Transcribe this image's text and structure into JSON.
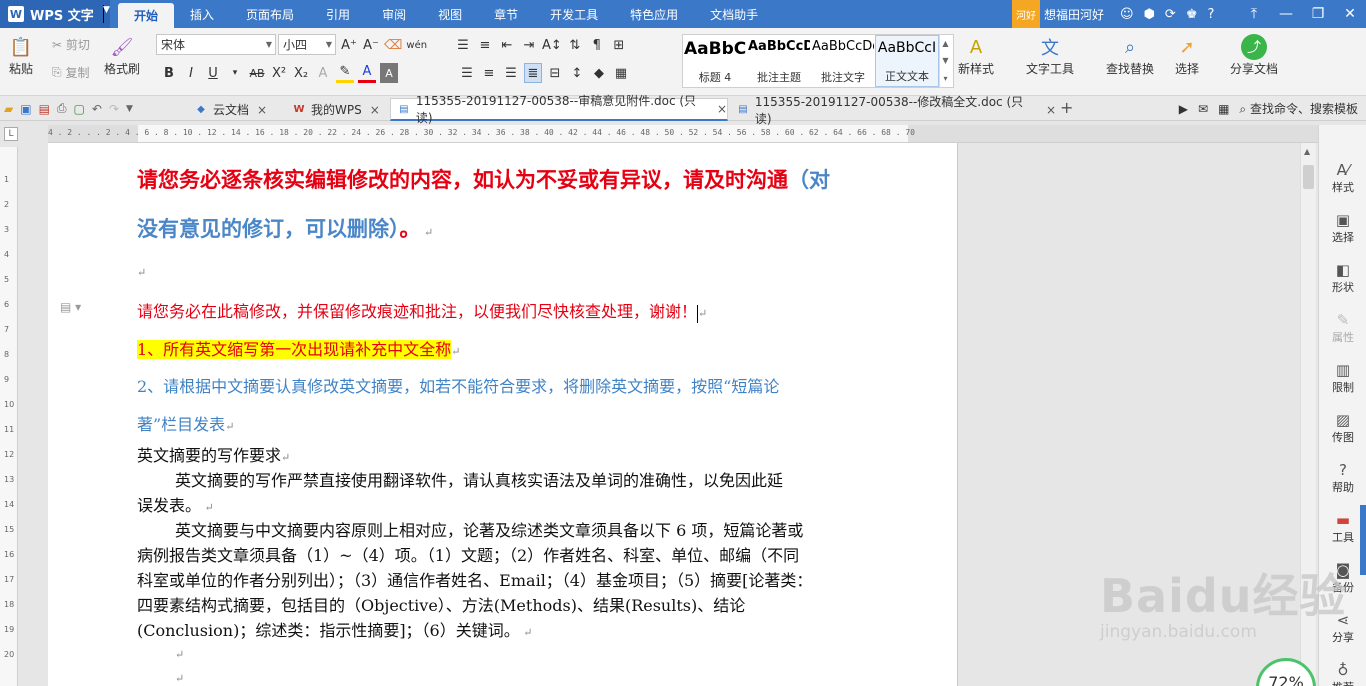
{
  "app": {
    "name": "WPS 文字",
    "logo": "W"
  },
  "menu": {
    "tabs": [
      "开始",
      "插入",
      "页面布局",
      "引用",
      "审阅",
      "视图",
      "章节",
      "开发工具",
      "特色应用",
      "文档助手"
    ],
    "user_badge": "河好",
    "user_name": "想福田河好"
  },
  "ribbon": {
    "paste": "粘贴",
    "cut": "剪切",
    "copy": "复制",
    "format_painter": "格式刷",
    "font_name": "宋体",
    "font_size": "小四",
    "styles": [
      {
        "sample": "AaBbC",
        "label": "标题 4"
      },
      {
        "sample": "AaBbCcDc",
        "label": "批注主题"
      },
      {
        "sample": "AaBbCcDd",
        "label": "批注文字"
      },
      {
        "sample": "AaBbCcI",
        "label": "正文文本"
      }
    ],
    "new_style": "新样式",
    "text_tools": "文字工具",
    "find_replace": "查找替换",
    "select": "选择",
    "share": "分享文档"
  },
  "tabs": {
    "cloud": "云文档",
    "mywps": "我的WPS",
    "doc1": "115355-20191127-00538--审稿意见附件.doc (只读)",
    "doc2": "115355-20191127-00538--修改稿全文.doc (只读)",
    "search": "查找命令、搜索模板"
  },
  "document": {
    "heading_red": "请您务必逐条核实编辑修改的内容，如认为不妥或有异议，请及时沟通",
    "heading_blue_1": "（对",
    "heading_blue_2": "没有意见的修订，可以删除）",
    "heading_end": "。",
    "note_red": "请您务必在此稿修改，并保留修改痕迹和批注，以便我们尽快核查处理，谢谢！",
    "item1": "1、所有英文缩写第一次出现请补充中文全称",
    "item2_a": "2、请根据中文摘要认真修改英文摘要，如若不能符合要求，将删除英文摘要，按照“短篇论",
    "item2_b": "著”栏目发表",
    "sub_title": "英文摘要的写作要求",
    "p1_a": "英文摘要的写作严禁直接使用翻译软件，请认真核实语法及单词的准确性，以免因此延",
    "p1_b": "误发表。",
    "p2_a": "英文摘要与中文摘要内容原则上相对应，论著及综述类文章须具备以下 6 项，短篇论著或",
    "p2_b": "病例报告类文章须具备（1）~（4）项。（1）文题；（2）作者姓名、科室、单位、邮编（不同",
    "p2_c": "科室或单位的作者分别列出）；（3）通信作者姓名、Email；（4）基金项目；（5）摘要[论著类：",
    "p2_d": "四要素结构式摘要，包括目的（Objective）、方法(Methods)、结果(Results)、结论",
    "p2_e": "(Conclusion)；综述类：指示性摘要]；（6）关键词。"
  },
  "side_panel": [
    "样式",
    "选择",
    "形状",
    "属性",
    "限制",
    "传图",
    "帮助",
    "工具",
    "备份",
    "分享",
    "推荐"
  ],
  "ruler_numbers": "4 . 2 . . . 2 . 4 . 6 . 8 . 10 . 12 . 14 . 16 . 18 . 20 . 22 . 24 . 26 . 28 . 30 . 32 . 34 . 36 . 38 . 40 . 42 . 44 . 46 . 48 . 50 . 52 . 54 . 56 . 58 . 60 . 62 . 64 . 66 . 68 . 70",
  "vruler_numbers": [
    "1",
    "2",
    "3",
    "4",
    "5",
    "6",
    "7",
    "8",
    "9",
    "10",
    "11",
    "12",
    "13",
    "14",
    "15",
    "16",
    "17",
    "18",
    "19",
    "20"
  ],
  "watermark": {
    "text": "Baidu经验",
    "url": "jingyan.baidu.com"
  },
  "zoom": "72%",
  "colors": {
    "accent": "#3b78c7",
    "red": "#e60012",
    "blue": "#3f83c5",
    "highlight": "#ffff00"
  }
}
